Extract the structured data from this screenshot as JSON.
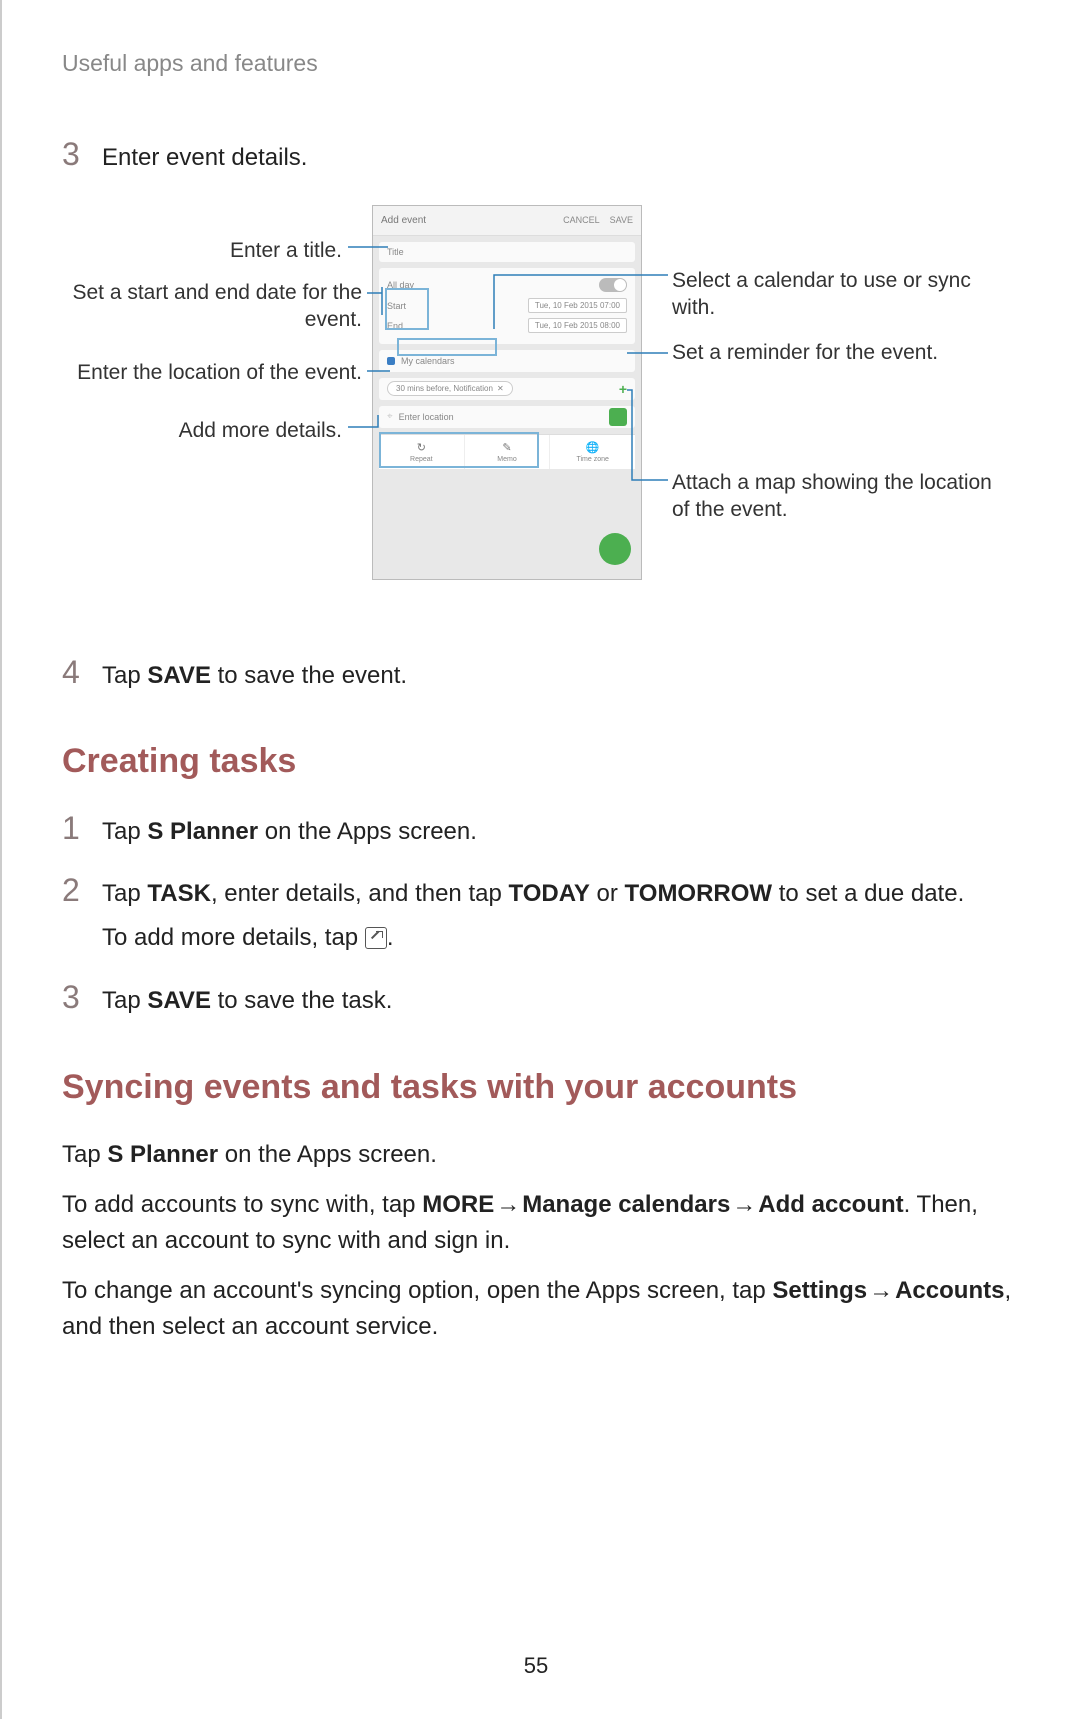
{
  "header": "Useful apps and features",
  "page_number": "55",
  "step3": {
    "num": "3",
    "text": "Enter event details."
  },
  "callouts": {
    "title": "Enter a title.",
    "dates": "Set a start and end date for the event.",
    "location": "Enter the location of the event.",
    "more": "Add more details.",
    "calendar": "Select a calendar to use or sync with.",
    "reminder": "Set a reminder for the event.",
    "map": "Attach a map showing the location of the event."
  },
  "mock": {
    "topbar_title": "Add event",
    "topbar_cancel": "CANCEL",
    "topbar_save": "SAVE",
    "title_placeholder": "Title",
    "allday": "All day",
    "start": "Start",
    "end": "End",
    "start_date": "Tue, 10 Feb 2015   07:00",
    "end_date": "Tue, 10 Feb 2015   08:00",
    "calendar": "My calendars",
    "reminder_pill": "30 mins before, Notification",
    "location_placeholder": "Enter location",
    "tab1": "Repeat",
    "tab2": "Memo",
    "tab3": "Time zone"
  },
  "step4": {
    "num": "4",
    "pre": "Tap ",
    "bold": "SAVE",
    "post": " to save the event."
  },
  "heading_tasks": "Creating tasks",
  "task1": {
    "num": "1",
    "pre": "Tap ",
    "bold": "S Planner",
    "post": " on the Apps screen."
  },
  "task2": {
    "num": "2",
    "pre": "Tap ",
    "b1": "TASK",
    "mid1": ", enter details, and then tap ",
    "b2": "TODAY",
    "mid2": " or ",
    "b3": "TOMORROW",
    "post": " to set a due date.",
    "sub_pre": "To add more details, tap ",
    "sub_post": "."
  },
  "task3": {
    "num": "3",
    "pre": "Tap ",
    "bold": "SAVE",
    "post": " to save the task."
  },
  "heading_sync": "Syncing events and tasks with your accounts",
  "sync_p1": {
    "pre": "Tap ",
    "bold": "S Planner",
    "post": " on the Apps screen."
  },
  "sync_p2": {
    "pre": "To add accounts to sync with, tap ",
    "b1": "MORE",
    "arrow": " → ",
    "b2": "Manage calendars",
    "b3": "Add account",
    "post": ". Then, select an account to sync with and sign in."
  },
  "sync_p3": {
    "pre": "To change an account's syncing option, open the Apps screen, tap ",
    "b1": "Settings",
    "arrow": " → ",
    "b2": "Accounts",
    "post": ", and then select an account service."
  }
}
